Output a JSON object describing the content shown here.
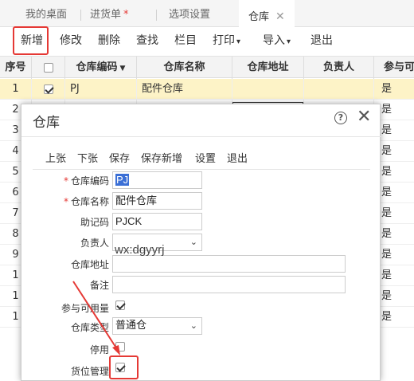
{
  "tabs": [
    {
      "label": "我的桌面"
    },
    {
      "label": "进货单",
      "modified": "*"
    },
    {
      "label": "选项设置"
    },
    {
      "label": "仓库",
      "close": "✕"
    }
  ],
  "toolbar": {
    "new": "新增",
    "edit": "修改",
    "delete": "删除",
    "find": "查找",
    "columns": "栏目",
    "print": "打印",
    "import": "导入",
    "exit": "退出"
  },
  "grid": {
    "headers": {
      "seq": "序号",
      "code": "仓库编码",
      "name": "仓库名称",
      "address": "仓库地址",
      "owner": "负责人",
      "available": "参与可用"
    },
    "rows": [
      {
        "seq": "1",
        "checked": true,
        "code": "PJ",
        "name": "配件仓库",
        "address": "",
        "owner": "",
        "available": "是"
      },
      {
        "seq": "2",
        "available": "是"
      },
      {
        "seq": "3",
        "available": "是"
      },
      {
        "seq": "4",
        "available": "是"
      },
      {
        "seq": "5",
        "available": "是"
      },
      {
        "seq": "6",
        "available": "是"
      },
      {
        "seq": "7",
        "available": "是"
      },
      {
        "seq": "8",
        "available": "是"
      },
      {
        "seq": "9",
        "available": "是"
      },
      {
        "seq": "1",
        "available": "是"
      },
      {
        "seq": "1",
        "available": "是"
      },
      {
        "seq": "1",
        "available": "是"
      }
    ]
  },
  "dialog": {
    "title": "仓库",
    "help": "?",
    "close": "✕",
    "toolbar": {
      "prev": "上张",
      "next": "下张",
      "save": "保存",
      "save_new": "保存新增",
      "settings": "设置",
      "exit": "退出"
    },
    "fields": {
      "code_label": "仓库编码",
      "code_value": "PJ",
      "name_label": "仓库名称",
      "name_value": "配件仓库",
      "mnemonic_label": "助记码",
      "mnemonic_value": "PJCK",
      "owner_label": "负责人",
      "owner_value": "",
      "address_label": "仓库地址",
      "address_value": "",
      "remark_label": "备注",
      "remark_value": "",
      "available_label": "参与可用量",
      "available_checked": true,
      "type_label": "仓库类型",
      "type_value": "普通仓",
      "disabled_label": "停用",
      "disabled_checked": false,
      "location_label": "货位管理",
      "location_checked": true,
      "required_mark": "*"
    },
    "watermark": "wx:dgyyrj"
  },
  "colors": {
    "highlight": "#e53935",
    "selected_row": "#fdf3c7",
    "selection_blue": "#3b6fd6"
  }
}
